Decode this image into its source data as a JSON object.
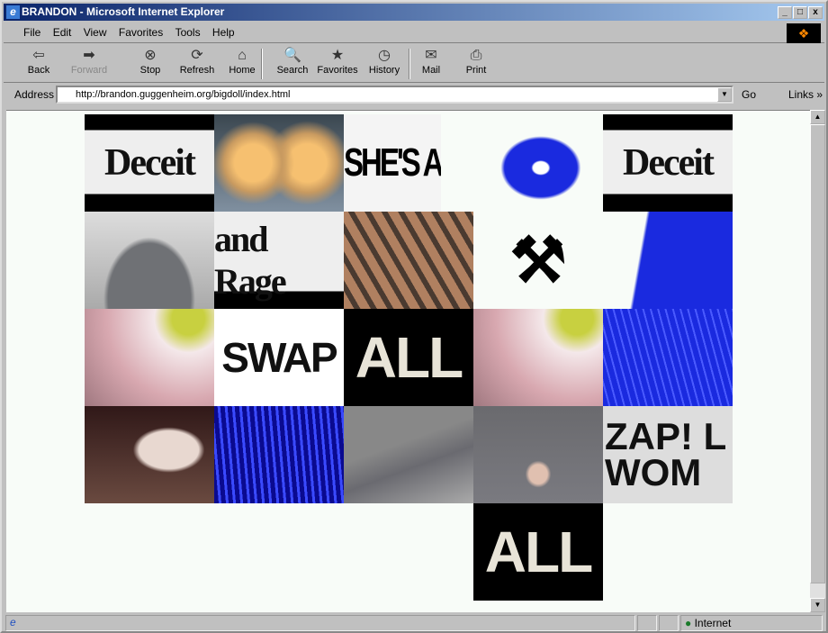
{
  "window": {
    "title": "BRANDON - Microsoft Internet Explorer",
    "controls": [
      "_",
      "□",
      "x"
    ]
  },
  "menu": [
    "File",
    "Edit",
    "View",
    "Favorites",
    "Tools",
    "Help"
  ],
  "toolbar": [
    {
      "label": "Back",
      "icon": "back-arrow-icon",
      "glyph": "⇦",
      "enabled": true
    },
    {
      "label": "Forward",
      "icon": "forward-arrow-icon",
      "glyph": "➡",
      "enabled": false
    },
    {
      "label": "Stop",
      "icon": "stop-icon",
      "glyph": "⊗",
      "enabled": true
    },
    {
      "label": "Refresh",
      "icon": "refresh-icon",
      "glyph": "⟳",
      "enabled": true
    },
    {
      "label": "Home",
      "icon": "home-icon",
      "glyph": "⌂",
      "enabled": true
    },
    {
      "label": "Search",
      "icon": "search-icon",
      "glyph": "🔍",
      "enabled": true
    },
    {
      "label": "Favorites",
      "icon": "favorites-icon",
      "glyph": "★",
      "enabled": true
    },
    {
      "label": "History",
      "icon": "history-icon",
      "glyph": "◷",
      "enabled": true
    },
    {
      "label": "Mail",
      "icon": "mail-icon",
      "glyph": "✉",
      "enabled": true
    },
    {
      "label": "Print",
      "icon": "print-icon",
      "glyph": "⎙",
      "enabled": true
    }
  ],
  "address": {
    "label": "Address",
    "url": "http://brandon.guggenheim.org/bigdoll/index.html",
    "go": "Go",
    "links": "Links »"
  },
  "tiles": [
    {
      "text": "Deceit"
    },
    {
      "text": ""
    },
    {
      "text": "SHE'S A HE"
    },
    {
      "text": ""
    },
    {
      "text": "Deceit"
    },
    {
      "text": ""
    },
    {
      "text": "and Rage"
    },
    {
      "text": ""
    },
    {
      "text": ""
    },
    {
      "text": ""
    },
    {
      "text": ""
    },
    {
      "text": "SWAP"
    },
    {
      "text": "ALL"
    },
    {
      "text": ""
    },
    {
      "text": ""
    },
    {
      "text": ""
    },
    {
      "text": ""
    },
    {
      "text": ""
    },
    {
      "text": ""
    },
    {
      "text": "ZAP! L WOM"
    },
    {
      "text": "ALL"
    }
  ],
  "status": {
    "zone": "Internet"
  }
}
